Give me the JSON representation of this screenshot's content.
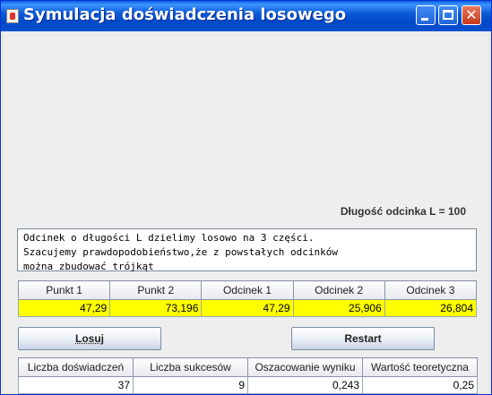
{
  "window": {
    "title": "Symulacja doświadczenia losowego"
  },
  "canvas": {
    "length_label": "Długość odcinka L = 100"
  },
  "description": {
    "lines": [
      "Odcinek o długości L dzielimy losowo na 3 części.",
      "Szacujemy prawdopodobieństwo,że z powstałych odcinków",
      "można zbudować trójkąt"
    ]
  },
  "points_table": {
    "headers": [
      "Punkt 1",
      "Punkt 2",
      "Odcinek 1",
      "Odcinek 2",
      "Odcinek 3"
    ],
    "values": [
      "47,29",
      "73,196",
      "47,29",
      "25,906",
      "26,804"
    ],
    "highlight_color": "#ffff00"
  },
  "buttons": {
    "losuj": "Losuj",
    "restart": "Restart"
  },
  "results_table": {
    "headers": [
      "Liczba doświadczeń",
      "Liczba sukcesów",
      "Oszacowanie wyniku",
      "Wartość teoretyczna"
    ],
    "values": [
      "37",
      "9",
      "0,243",
      "0,25"
    ]
  },
  "colors": {
    "titlebar": "#0b5bd8",
    "window_bg": "#eeeeee"
  }
}
